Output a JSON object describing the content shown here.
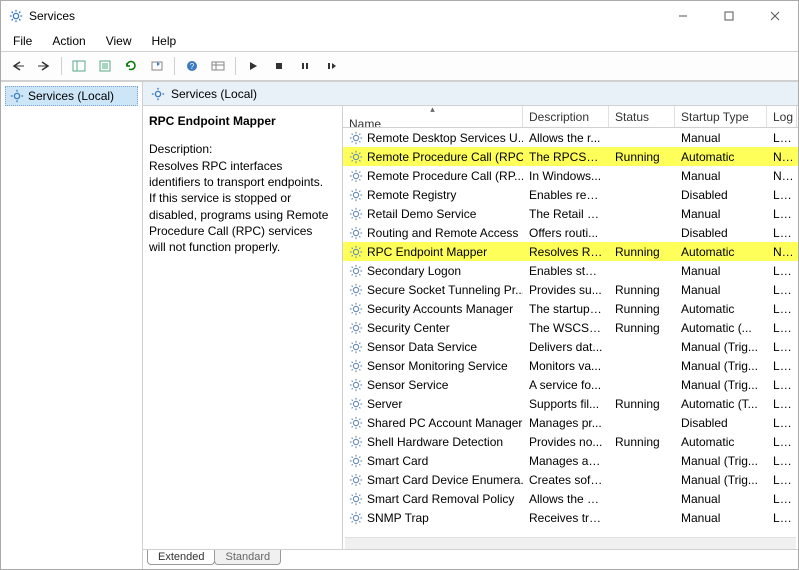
{
  "window": {
    "title": "Services"
  },
  "menu": {
    "file": "File",
    "action": "Action",
    "view": "View",
    "help": "Help"
  },
  "tree": {
    "root": "Services (Local)"
  },
  "right_header": "Services (Local)",
  "detail": {
    "selected_name": "RPC Endpoint Mapper",
    "desc_label": "Description:",
    "desc_text": "Resolves RPC interfaces identifiers to transport endpoints. If this service is stopped or disabled, programs using Remote Procedure Call (RPC) services will not function properly."
  },
  "columns": {
    "name": "Name",
    "description": "Description",
    "status": "Status",
    "startup": "Startup Type",
    "logon": "Log"
  },
  "services": [
    {
      "name": "Remote Desktop Services U...",
      "desc": "Allows the r...",
      "status": "",
      "startup": "Manual",
      "logon": "Loc",
      "hl": false
    },
    {
      "name": "Remote Procedure Call (RPC)",
      "desc": "The RPCSS s...",
      "status": "Running",
      "startup": "Automatic",
      "logon": "Net",
      "hl": true
    },
    {
      "name": "Remote Procedure Call (RP...",
      "desc": "In Windows...",
      "status": "",
      "startup": "Manual",
      "logon": "Net",
      "hl": false
    },
    {
      "name": "Remote Registry",
      "desc": "Enables rem...",
      "status": "",
      "startup": "Disabled",
      "logon": "Loc",
      "hl": false
    },
    {
      "name": "Retail Demo Service",
      "desc": "The Retail D...",
      "status": "",
      "startup": "Manual",
      "logon": "Loc",
      "hl": false
    },
    {
      "name": "Routing and Remote Access",
      "desc": "Offers routi...",
      "status": "",
      "startup": "Disabled",
      "logon": "Loc",
      "hl": false
    },
    {
      "name": "RPC Endpoint Mapper",
      "desc": "Resolves RP...",
      "status": "Running",
      "startup": "Automatic",
      "logon": "Net",
      "hl": true
    },
    {
      "name": "Secondary Logon",
      "desc": "Enables star...",
      "status": "",
      "startup": "Manual",
      "logon": "Loc",
      "hl": false
    },
    {
      "name": "Secure Socket Tunneling Pr...",
      "desc": "Provides su...",
      "status": "Running",
      "startup": "Manual",
      "logon": "Loc",
      "hl": false
    },
    {
      "name": "Security Accounts Manager",
      "desc": "The startup ...",
      "status": "Running",
      "startup": "Automatic",
      "logon": "Loc",
      "hl": false
    },
    {
      "name": "Security Center",
      "desc": "The WSCSV...",
      "status": "Running",
      "startup": "Automatic (...",
      "logon": "Loc",
      "hl": false
    },
    {
      "name": "Sensor Data Service",
      "desc": "Delivers dat...",
      "status": "",
      "startup": "Manual (Trig...",
      "logon": "Loc",
      "hl": false
    },
    {
      "name": "Sensor Monitoring Service",
      "desc": "Monitors va...",
      "status": "",
      "startup": "Manual (Trig...",
      "logon": "Loc",
      "hl": false
    },
    {
      "name": "Sensor Service",
      "desc": "A service fo...",
      "status": "",
      "startup": "Manual (Trig...",
      "logon": "Loc",
      "hl": false
    },
    {
      "name": "Server",
      "desc": "Supports fil...",
      "status": "Running",
      "startup": "Automatic (T...",
      "logon": "Loc",
      "hl": false
    },
    {
      "name": "Shared PC Account Manager",
      "desc": "Manages pr...",
      "status": "",
      "startup": "Disabled",
      "logon": "Loc",
      "hl": false
    },
    {
      "name": "Shell Hardware Detection",
      "desc": "Provides no...",
      "status": "Running",
      "startup": "Automatic",
      "logon": "Loc",
      "hl": false
    },
    {
      "name": "Smart Card",
      "desc": "Manages ac...",
      "status": "",
      "startup": "Manual (Trig...",
      "logon": "Loc",
      "hl": false
    },
    {
      "name": "Smart Card Device Enumera...",
      "desc": "Creates soft...",
      "status": "",
      "startup": "Manual (Trig...",
      "logon": "Loc",
      "hl": false
    },
    {
      "name": "Smart Card Removal Policy",
      "desc": "Allows the s...",
      "status": "",
      "startup": "Manual",
      "logon": "Loc",
      "hl": false
    },
    {
      "name": "SNMP Trap",
      "desc": "Receives tra...",
      "status": "",
      "startup": "Manual",
      "logon": "Loc",
      "hl": false
    }
  ],
  "tabs": {
    "extended": "Extended",
    "standard": "Standard"
  }
}
